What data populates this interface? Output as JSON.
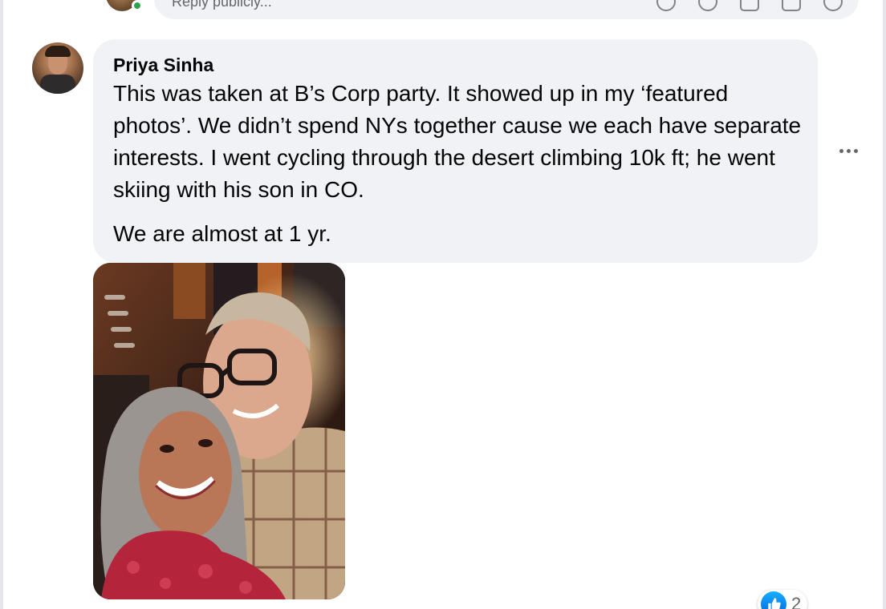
{
  "composer": {
    "placeholder": "Reply publicly..."
  },
  "comment": {
    "author": "Priya Sinha",
    "paragraph1": "This was taken at B’s Corp party. It showed up in my ‘featured photos’. We didn’t spend NYs together cause we each have separate interests. I went cycling through the desert climbing 10k ft; he went skiing with his son in CO.",
    "paragraph2": "We are almost at 1 yr.",
    "more_label": "•••",
    "reaction_count": "2"
  },
  "colors": {
    "bubble": "#f0f2f5",
    "online": "#31a24c",
    "like": "#1877f2",
    "secondary_text": "#65676b"
  },
  "icons": [
    "camera-icon",
    "emoji-icon",
    "gif-icon",
    "sticker-icon",
    "like-reaction-icon",
    "more-options-icon"
  ]
}
